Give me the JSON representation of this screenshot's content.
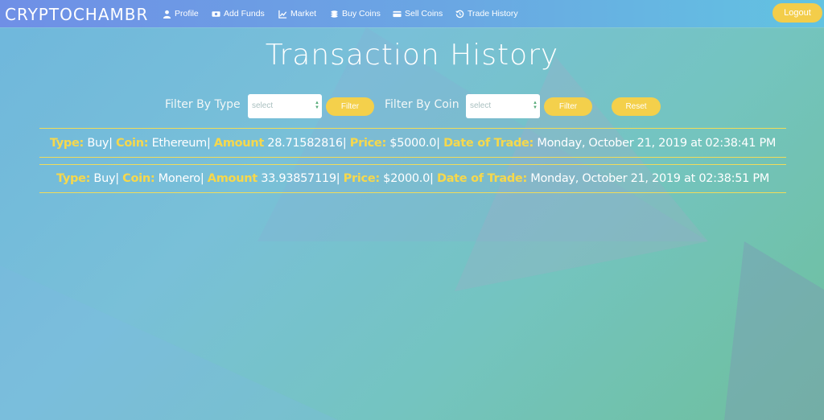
{
  "brand": "CRYPTOCHAMBR",
  "nav": {
    "profile": "Profile",
    "add_funds": "Add Funds",
    "market": "Market",
    "buy_coins": "Buy Coins",
    "sell_coins": "Sell Coins",
    "trade_history": "Trade History",
    "logout": "Logout"
  },
  "page_title": "Transaction History",
  "filters": {
    "type_label": "Filter By Type",
    "type_select": "select",
    "type_button": "Filter",
    "coin_label": "Filter By Coin",
    "coin_select": "select",
    "coin_button": "Filter",
    "reset_button": "Reset"
  },
  "labels": {
    "type": "Type:",
    "coin": "Coin:",
    "amount": "Amount",
    "price": "Price:",
    "date": "Date of Trade:"
  },
  "transactions": [
    {
      "type": "Buy",
      "coin": "Ethereum",
      "amount": "28.71582816",
      "price": "$5000.0",
      "date": "Monday, October 21, 2019 at 02:38:41 PM"
    },
    {
      "type": "Buy",
      "coin": "Monero",
      "amount": "33.93857119",
      "price": "$2000.0",
      "date": "Monday, October 21, 2019 at 02:38:51 PM"
    }
  ],
  "colors": {
    "accent_yellow": "#f4d04b",
    "nav_gradient_start": "#6f8fe6",
    "nav_gradient_end": "#62c3e1",
    "bg_start": "#6fb7dc",
    "bg_end": "#6ebf9c"
  },
  "icons": {
    "profile": "user-icon",
    "add_funds": "money-icon",
    "market": "chart-icon",
    "buy_coins": "coins-icon",
    "sell_coins": "card-icon",
    "trade_history": "history-icon"
  }
}
